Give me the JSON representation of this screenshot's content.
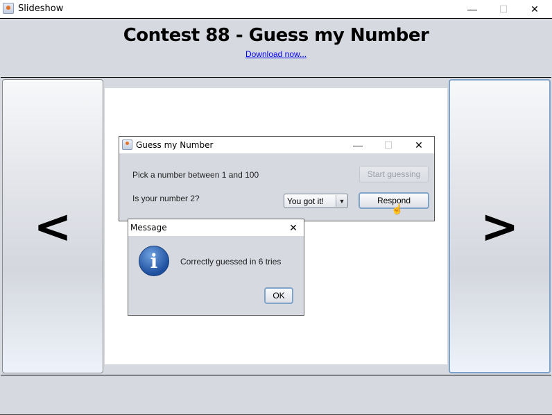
{
  "window": {
    "title": "Slideshow",
    "icons": {
      "app": "java-cup-icon",
      "minimize": "minimize-icon",
      "maximize": "maximize-icon",
      "close": "close-icon"
    },
    "minimize_glyph": "—",
    "maximize_glyph": "☐",
    "close_glyph": "✕"
  },
  "header": {
    "title": "Contest 88 - Guess my Number",
    "link": "Download now..."
  },
  "nav": {
    "prev_label": "<",
    "next_label": ">"
  },
  "slide": {
    "guess_window": {
      "title": "Guess my Number",
      "minimize_glyph": "—",
      "maximize_glyph": "☐",
      "close_glyph": "✕",
      "pick_label": "Pick a number between 1 and 100",
      "start_button": "Start guessing",
      "start_button_enabled": false,
      "question_label": "Is your number 2?",
      "response_selected": "You got it!",
      "dropdown_arrow": "▼",
      "respond_button": "Respond",
      "cursor_glyph": "☝"
    },
    "message_dialog": {
      "title": "Message",
      "close_glyph": "✕",
      "icon_glyph": "i",
      "text": "Correctly guessed in 6 tries",
      "ok_button": "OK"
    }
  },
  "footer": {}
}
